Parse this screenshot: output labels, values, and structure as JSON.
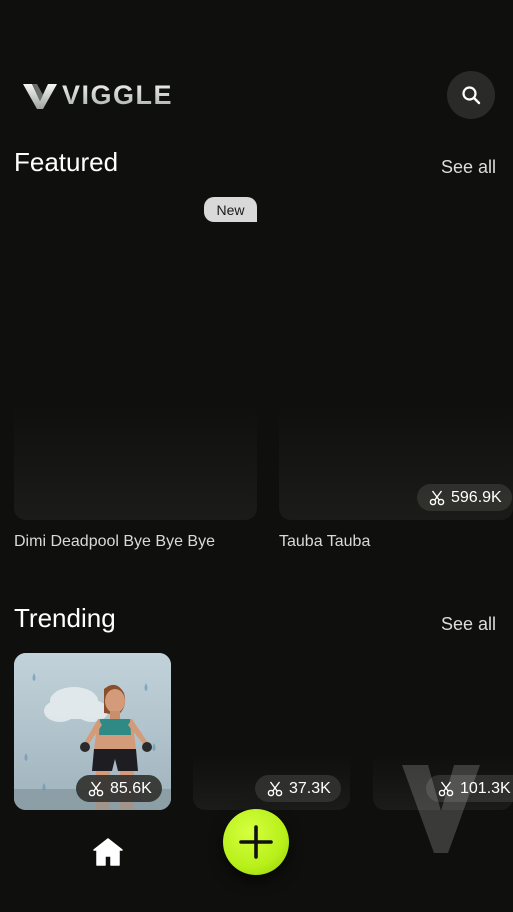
{
  "header": {
    "brand": "VIGGLE"
  },
  "featured": {
    "title": "Featured",
    "see_all": "See all",
    "items": [
      {
        "label": "Dimi Deadpool Bye Bye Bye",
        "badge": "New"
      },
      {
        "label": "Tauba Tauba",
        "count": "596.9K"
      }
    ]
  },
  "trending": {
    "title": "Trending",
    "see_all": "See all",
    "items": [
      {
        "count": "85.6K"
      },
      {
        "count": "37.3K"
      },
      {
        "count": "101.3K"
      }
    ]
  },
  "icons": {
    "search": "search-icon",
    "stat": "scissors-icon",
    "home": "home-icon",
    "create": "plus-icon"
  },
  "colors": {
    "accent": "#b8f01a",
    "background": "#0f100d"
  }
}
